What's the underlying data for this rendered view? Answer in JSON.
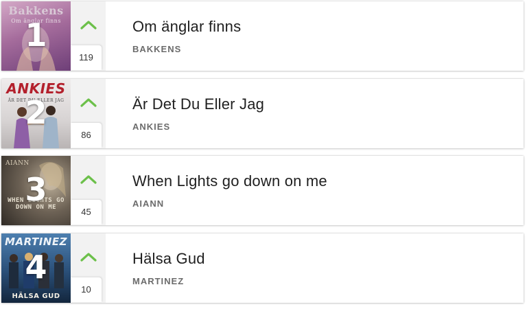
{
  "songs": [
    {
      "rank": "1",
      "title": "Om änglar finns",
      "artist": "BAKKENS",
      "votes": "119",
      "cover_text": "Bakkens",
      "cover_subtext": "Om änglar finns",
      "cover_colors": [
        "#c89ab8",
        "#7e4f85"
      ]
    },
    {
      "rank": "2",
      "title": "Är Det Du Eller Jag",
      "artist": "ANKIES",
      "votes": "86",
      "cover_text": "ANKIES",
      "cover_subtext": "ÄR DET DU ELLER JAG",
      "cover_colors": [
        "#e9e6e6",
        "#b5b1b1"
      ]
    },
    {
      "rank": "3",
      "title": "When Lights go down on me",
      "artist": "AIANN",
      "votes": "45",
      "cover_text": "AIANN",
      "cover_subtext": "WHEN LIGHTS GO DOWN ON ME",
      "cover_colors": [
        "#8a7f71",
        "#3b3530"
      ]
    },
    {
      "rank": "4",
      "title": "Hälsa Gud",
      "artist": "MARTINEZ",
      "votes": "10",
      "cover_text": "MARTINEZ",
      "cover_subtext": "HÄLSA GUD",
      "cover_colors": [
        "#3f6f9e",
        "#16304e"
      ]
    }
  ],
  "icons": {
    "vote": "chevron-up-icon"
  },
  "colors": {
    "accent": "#6cc04a",
    "vote_bg": "#f2f2f2",
    "title": "#1f1f1f",
    "artist": "#6b6b6b"
  }
}
